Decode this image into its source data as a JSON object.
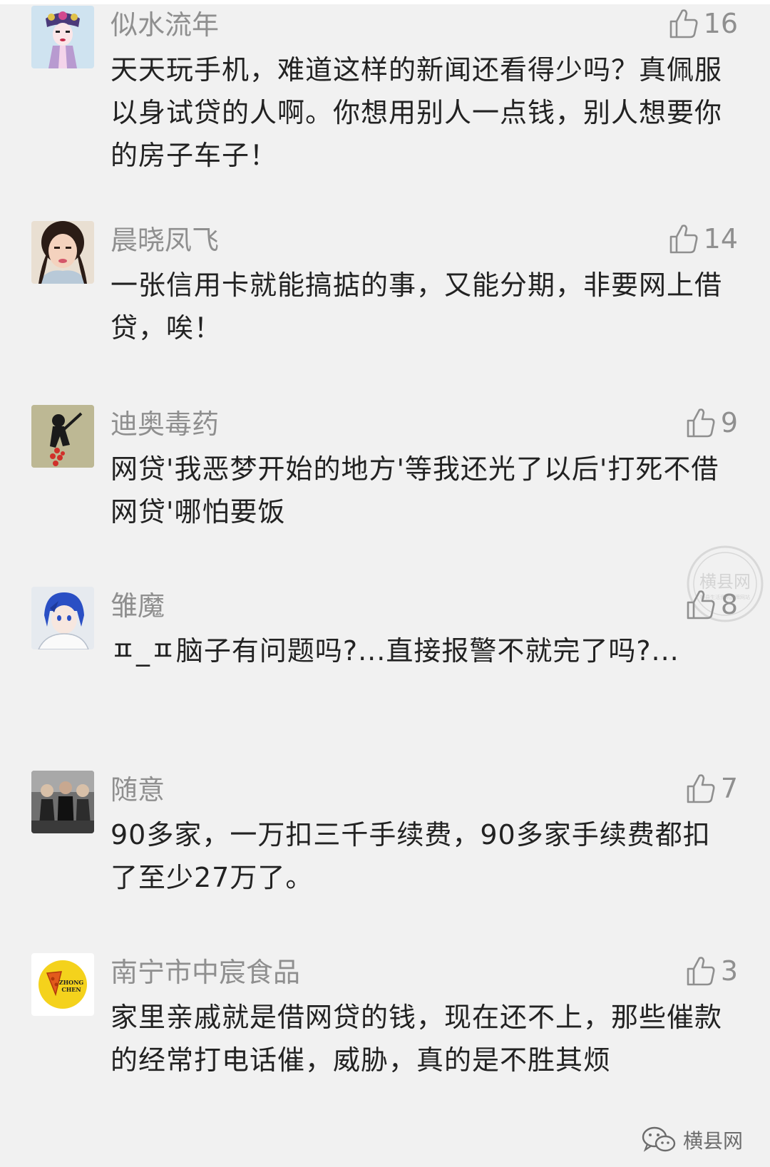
{
  "comments": [
    {
      "name": "似水流年",
      "likes": "16",
      "text": "天天玩手机，难道这样的新闻还看得少吗？真佩服以身试贷的人啊。你想用别人一点钱，别人想要你的房子车子！",
      "avatar": "opera-mask"
    },
    {
      "name": "晨晓凤飞",
      "likes": "14",
      "text": "一张信用卡就能搞掂的事，又能分期，非要网上借贷，唉！",
      "avatar": "woman-portrait"
    },
    {
      "name": "迪奥毒药",
      "likes": "9",
      "text": "网贷'我恶梦开始的地方'等我还光了以后'打死不借网贷'哪怕要饭",
      "avatar": "art-figure"
    },
    {
      "name": "雏魔",
      "likes": "8",
      "text": "ㅍ_ㅍ脑子有问题吗?...直接报警不就完了吗?...",
      "avatar": "anime-boy"
    },
    {
      "name": "随意",
      "likes": "7",
      "text": "90多家，一万扣三千手续费，90多家手续费都扣了至少27万了。",
      "avatar": "group-photo"
    },
    {
      "name": "南宁市中宸食品",
      "likes": "3",
      "text": "家里亲戚就是借网贷的钱，现在还不上，那些催款的经常打电话催，威胁，真的是不胜其烦",
      "avatar": "zhongchen-logo"
    }
  ],
  "watermark": {
    "text": "横县网",
    "subtext": "横县生活资讯品牌网站"
  },
  "brand": {
    "label": "横县网",
    "icon": "wechat-icon"
  },
  "logo_text": "ZHONG CHEN"
}
